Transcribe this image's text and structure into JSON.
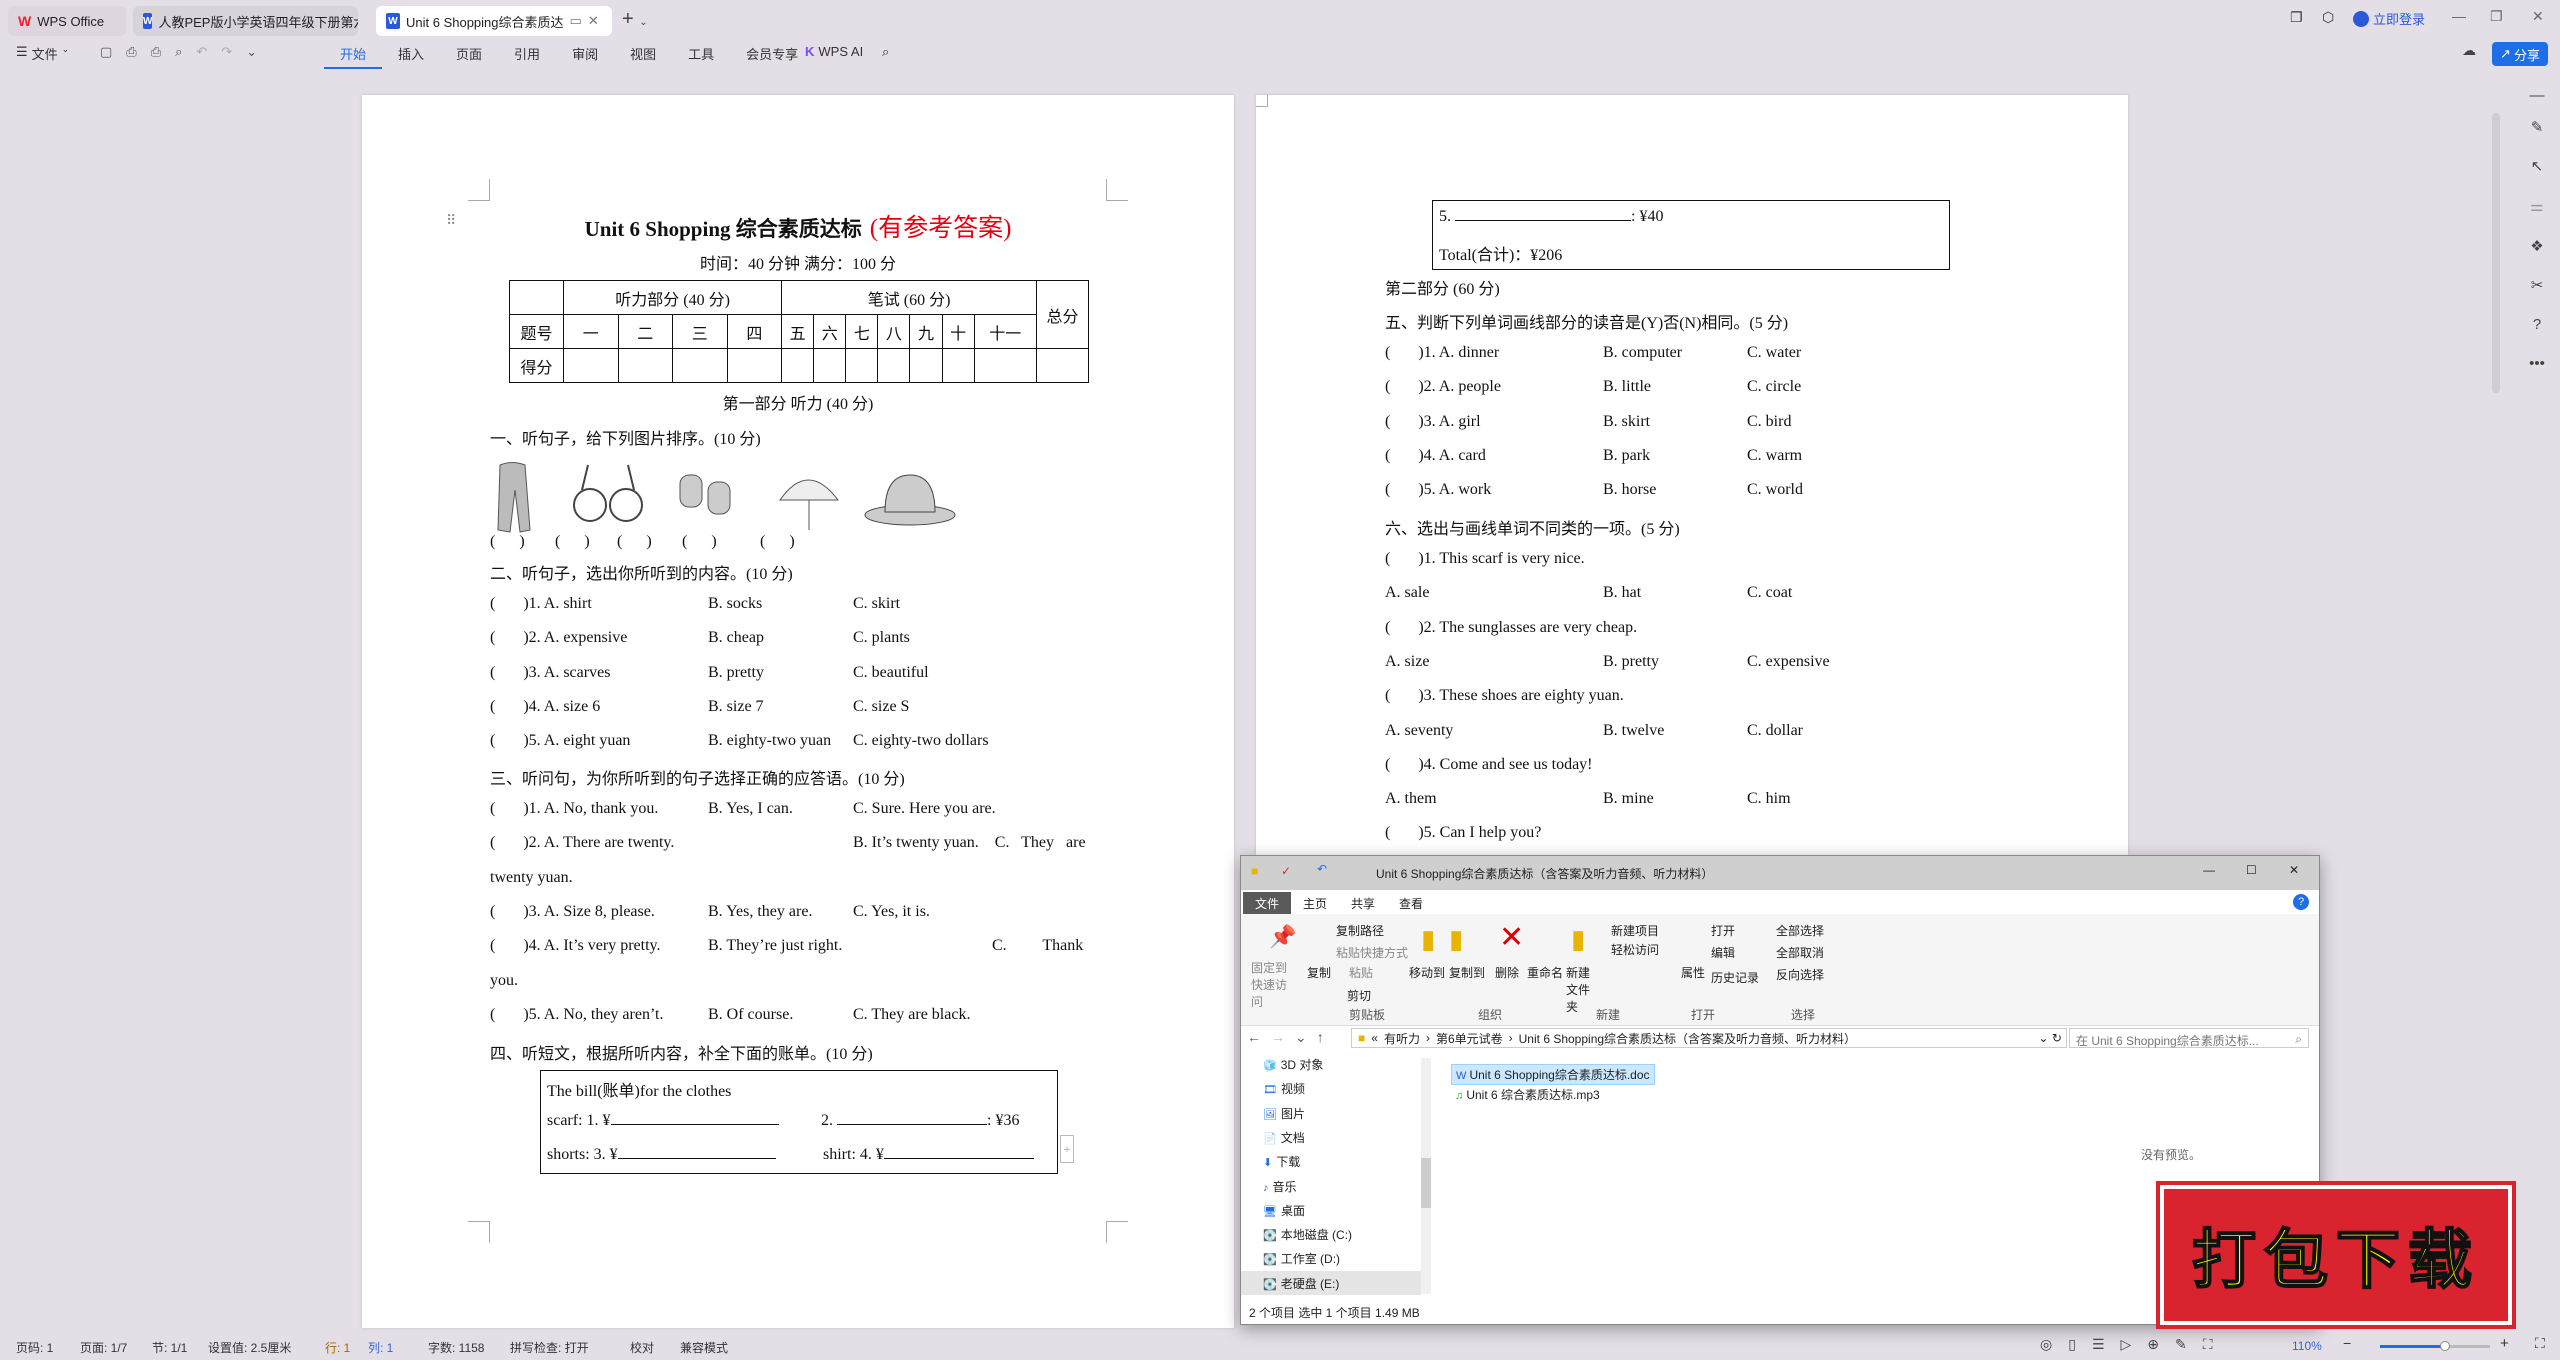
{
  "tabs": [
    {
      "label": "WPS Office",
      "icon": "wps-logo-icon"
    },
    {
      "label": "人教PEP版小学英语四年级下册第六单"
    },
    {
      "label": "Unit 6   Shopping综合素质达"
    }
  ],
  "titlebar": {
    "login": "立即登录",
    "share": "分享"
  },
  "menu": {
    "file": "文件",
    "items": [
      "开始",
      "插入",
      "页面",
      "引用",
      "审阅",
      "视图",
      "工具",
      "会员专享"
    ],
    "active": "开始",
    "ai": "WPS AI"
  },
  "doc": {
    "title": "Unit 6     Shopping 综合素质达标",
    "title_note": "(有参考答案)",
    "title_note_color": "#e60012",
    "subtitle": "时间：40 分钟   满分：100 分",
    "score_table": {
      "listening": "听力部分 (40 分)",
      "written": "笔试 (60 分)",
      "total": "总分",
      "row_q": "题号",
      "row_s": "得分",
      "cols": [
        "一",
        "二",
        "三",
        "四",
        "五",
        "六",
        "七",
        "八",
        "九",
        "十",
        "十一"
      ]
    },
    "part1": "第一部分   听力 (40 分)",
    "s1": "一、听句子，给下列图片排序。(10  分)",
    "s1_pictures": [
      "scarf",
      "sunglasses",
      "mittens",
      "umbrella",
      "hat"
    ],
    "paren": "(      )",
    "s2": "二、听句子，选出你所听到的内容。(10  分)",
    "s2_rows": [
      [
        "(       )1. A. shirt",
        "B. socks",
        "C. skirt"
      ],
      [
        "(       )2. A. expensive",
        "B. cheap",
        "C. plants"
      ],
      [
        "(       )3. A. scarves",
        "B. pretty",
        "C. beautiful"
      ],
      [
        "(       )4. A. size 6",
        "B. size 7",
        "C. size S"
      ],
      [
        "(       )5. A. eight yuan",
        "B. eighty-two yuan",
        "C. eighty-two dollars"
      ]
    ],
    "s3": "三、听问句，为你所听到的句子选择正确的应答语。(10  分)",
    "s3_rows": [
      [
        "(       )1. A. No, thank you.",
        "B. Yes, I can.",
        "C. Sure. Here you are.",
        ""
      ],
      [
        "(       )2. A. There are twenty.",
        "",
        "B. It’s twenty yuan.    C.   They   are",
        ""
      ],
      [
        "twenty yuan.",
        "",
        "",
        ""
      ],
      [
        "(       )3. A. Size 8, please.",
        "B. Yes, they are.",
        "C. Yes, it is.",
        ""
      ],
      [
        "(       )4. A. It’s very pretty.",
        "B. They’re just right.",
        "",
        "C.         Thank"
      ],
      [
        "you.",
        "",
        "",
        ""
      ],
      [
        "(       )5. A. No, they aren’t.",
        "B. Of course.",
        "C. They are black.",
        ""
      ]
    ],
    "s4": "四、听短文，根据所听内容，补全下面的账单。(10  分)",
    "bill": {
      "heading": "The bill(账单)for the clothes",
      "l1a": "scarf: 1. ¥",
      "l1b": "2.",
      "l1c": ": ¥36",
      "l2a": "shorts: 3. ¥",
      "l2b": "shirt: 4. ¥",
      "l3a": "5.",
      "l3b": ": ¥40",
      "total": "Total(合计)：¥206"
    },
    "part2": "第二部分  (60  分)",
    "s5": "五、判断下列单词画线部分的读音是(Y)否(N)相同。(5  分)",
    "s5_rows": [
      [
        "(       )1. A. dinner",
        "B. computer",
        "C. water"
      ],
      [
        "(       )2. A. people",
        "B. little",
        "C. circle"
      ],
      [
        "(       )3. A. girl",
        "B. skirt",
        "C. bird"
      ],
      [
        "(       )4. A. card",
        "B. park",
        "C. warm"
      ],
      [
        "(       )5. A. work",
        "B. horse",
        "C. world"
      ]
    ],
    "s6": "六、选出与画线单词不同类的一项。(5  分)",
    "s6_rows": [
      [
        "(       )1. This scarf is very nice.",
        "",
        ""
      ],
      [
        "A. sale",
        "B. hat",
        "C. coat"
      ],
      [
        "(       )2. The sunglasses are very cheap.",
        "",
        ""
      ],
      [
        "A. size",
        "B. pretty",
        "C. expensive"
      ],
      [
        "(       )3. These shoes are eighty yuan.",
        "",
        ""
      ],
      [
        "A. seventy",
        "B. twelve",
        "C. dollar"
      ],
      [
        "(       )4. Come and see us today!",
        "",
        ""
      ],
      [
        "A. them",
        "B. mine",
        "C. him"
      ],
      [
        "(       )5. Can I help you?",
        "",
        ""
      ]
    ]
  },
  "explorer": {
    "title": "Unit 6 Shopping综合素质达标（含答案及听力音频、听力材料）",
    "tabs": [
      "文件",
      "主页",
      "共享",
      "查看"
    ],
    "ribbon": {
      "pin": "固定到快速访问",
      "copy": "复制",
      "paste": "粘贴",
      "copy_path": "复制路径",
      "paste_shortcut": "粘贴快捷方式",
      "cut": "剪切",
      "move_to": "移动到",
      "copy_to": "复制到",
      "delete": "删除",
      "rename": "重命名",
      "new_folder": "新建文件夹",
      "new_item": "新建项目",
      "easy_access": "轻松访问",
      "properties": "属性",
      "open": "打开",
      "edit": "编辑",
      "history": "历史记录",
      "select_all": "全部选择",
      "select_none": "全部取消",
      "invert": "反向选择"
    },
    "groups": [
      "剪贴板",
      "组织",
      "新建",
      "打开",
      "选择"
    ],
    "breadcrumb": [
      "有听力",
      "第6单元试卷",
      "Unit 6 Shopping综合素质达标（含答案及听力音频、听力材料）"
    ],
    "search_placeholder": "在 Unit 6 Shopping综合素质达标...",
    "nav": [
      "3D 对象",
      "视频",
      "图片",
      "文档",
      "下载",
      "音乐",
      "桌面",
      "本地磁盘 (C:)",
      "工作室 (D:)",
      "老硬盘 (E:)"
    ],
    "files": [
      {
        "name": "Unit 6   Shopping综合素质达标.doc",
        "selected": true
      },
      {
        "name": "Unit 6 综合素质达标.mp3",
        "selected": false
      }
    ],
    "no_preview": "没有预览。",
    "status": "2 个项目    选中 1 个项目  1.49 MB"
  },
  "stamp": {
    "text": "打包下载",
    "bg": "#d9232e",
    "fg": "#ffff00"
  },
  "statusbar": {
    "page_num": "页码: 1",
    "page": "页面: 1/7",
    "section": "节: 1/1",
    "setting": "设置值: 2.5厘米",
    "row": "行: 1",
    "col": "列: 1",
    "words": "字数: 1158",
    "spell": "拼写检查: 打开",
    "proof": "校对",
    "compat": "兼容模式",
    "zoom": "110%",
    "zoom_level": 110
  },
  "colors": {
    "accent": "#1e6ee8",
    "bg": "#e4dee6"
  }
}
